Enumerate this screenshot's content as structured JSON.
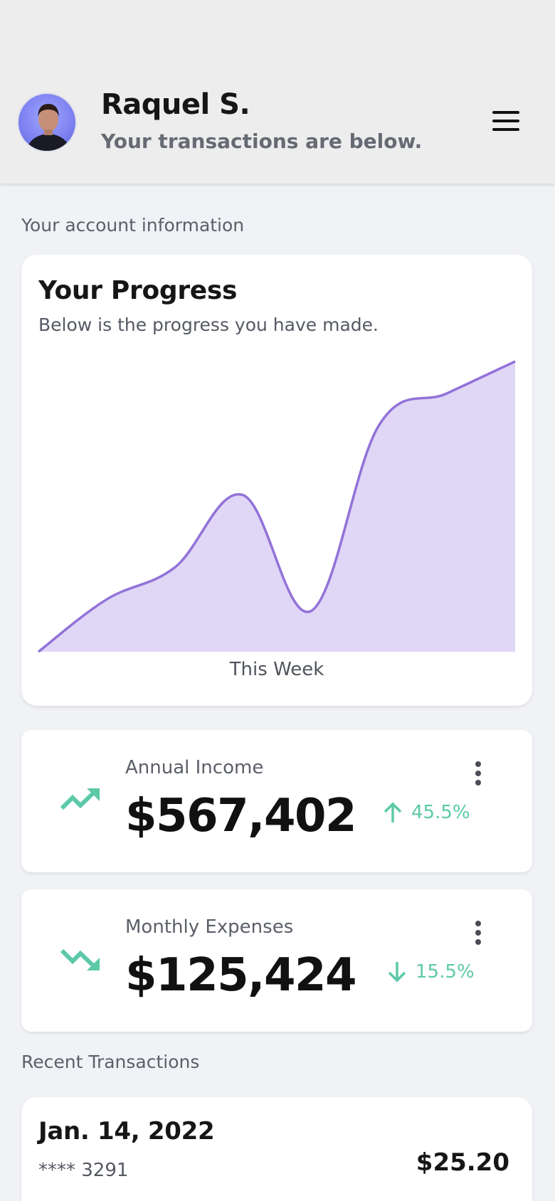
{
  "header": {
    "name": "Raquel S.",
    "subtitle": "Your transactions are below.",
    "avatar_icon": "person-avatar",
    "menu_icon": "hamburger-menu-icon"
  },
  "account_section_label": "Your account information",
  "progress": {
    "title": "Your Progress",
    "subtitle": "Below is the progress you have made."
  },
  "chart_data": {
    "type": "area",
    "title": "Your Progress",
    "subtitle": "Below is the progress you have made.",
    "xlabel": "This Week",
    "ylabel": "",
    "x": [
      0,
      1,
      2,
      3,
      4,
      5,
      6,
      7
    ],
    "values": [
      0,
      18,
      29,
      54,
      14,
      78,
      89,
      100
    ],
    "ylim": [
      0,
      100
    ],
    "grid": false,
    "legend": "none",
    "line_color": "#9272d8",
    "fill_color": "#e0d6f6"
  },
  "stats": [
    {
      "label": "Annual Income",
      "value": "$567,402",
      "change": "45.5%",
      "direction": "up",
      "trend_icon": "trending-up-icon"
    },
    {
      "label": "Monthly Expenses",
      "value": "$125,424",
      "change": "15.5%",
      "direction": "down",
      "trend_icon": "trending-down-icon"
    }
  ],
  "transactions_section_label": "Recent Transactions",
  "transactions": [
    {
      "date": "Jan. 14, 2022",
      "card": "**** 3291",
      "amount": "$25.20"
    }
  ],
  "colors": {
    "accent_teal": "#5cc9a8",
    "chart_line": "#9272d8",
    "chart_fill": "#e0d6f6",
    "header_bg": "#ededee",
    "page_bg": "#f1f2f6"
  }
}
